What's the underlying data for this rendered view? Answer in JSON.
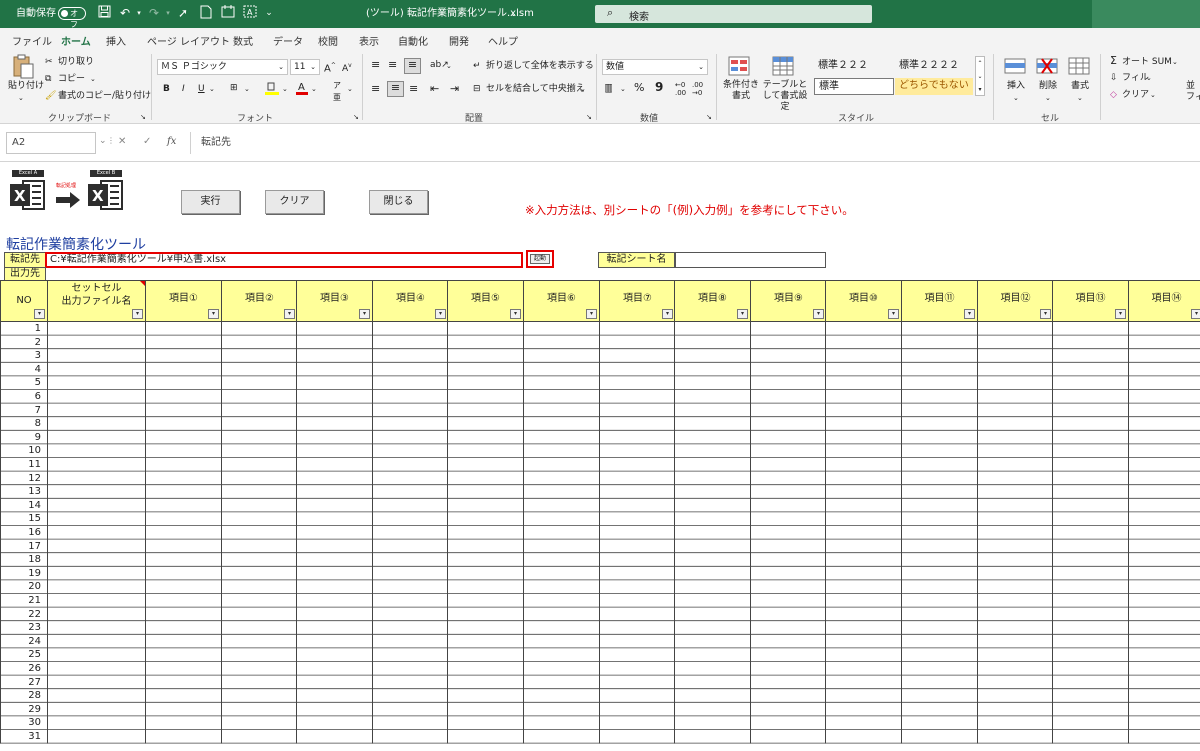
{
  "titlebar": {
    "autosave_label": "自動保存",
    "autosave_state": "オフ",
    "file_title": "(ツール) 転記作業簡素化ツール.xlsm",
    "search_placeholder": "検索"
  },
  "tabs": [
    "ファイル",
    "ホーム",
    "挿入",
    "ページ レイアウト",
    "数式",
    "データ",
    "校閲",
    "表示",
    "自動化",
    "開発",
    "ヘルプ"
  ],
  "active_tab": "ホーム",
  "ribbon": {
    "clipboard": {
      "paste": "貼り付け",
      "cut": "切り取り",
      "copy": "コピー",
      "format_painter": "書式のコピー/貼り付け",
      "label": "クリップボード"
    },
    "font": {
      "font_name": "ＭＳ Ｐゴシック",
      "font_size": "11",
      "bold": "B",
      "italic": "I",
      "underline": "U",
      "label": "フォント"
    },
    "alignment": {
      "wrap_text": "折り返して全体を表示する",
      "merge_center": "セルを結合して中央揃え",
      "label": "配置"
    },
    "number": {
      "format": "数値",
      "percent": "%",
      "comma": "9",
      "label": "数値"
    },
    "styles": {
      "conditional": "条件付き書式",
      "table": "テーブルとして書式設定",
      "style1": "標準２２２",
      "style2": "標準２２２２",
      "style3": "標準",
      "style4": "どちらでもない",
      "label": "スタイル"
    },
    "cells": {
      "insert": "挿入",
      "delete": "削除",
      "format": "書式",
      "label": "セル"
    },
    "editing": {
      "autosum": "オート SUM",
      "fill": "フィル",
      "clear": "クリア",
      "sort_partial": "並",
      "fi_partial": "フィ"
    }
  },
  "formula_bar": {
    "name_box": "A2",
    "fx": "fx",
    "content": "転記先"
  },
  "sheet": {
    "logo_a": "Excel A",
    "logo_b": "Excel B",
    "arrow_caption": "転記処理",
    "buttons": {
      "run": "実行",
      "clear": "クリア",
      "close": "閉じる"
    },
    "note": "※入力方法は、別シートの「(例)入力例」を参考にして下さい。",
    "tool_title": "転記作業簡素化ツール",
    "dest_label": "転記先",
    "dest_path": "C:¥転記作業簡素化ツール¥申込書.xlsx",
    "launch_button": "起動",
    "sheet_name_label": "転記シート名",
    "output_label": "出力先",
    "headers": {
      "no": "NO",
      "set_cell": "セットセル",
      "output_file": "出力ファイル名",
      "items": [
        "項目①",
        "項目②",
        "項目③",
        "項目④",
        "項目⑤",
        "項目⑥",
        "項目⑦",
        "項目⑧",
        "項目⑨",
        "項目⑩",
        "項目⑪",
        "項目⑫",
        "項目⑬",
        "項目⑭"
      ]
    },
    "row_numbers": [
      "1",
      "2",
      "3",
      "4",
      "5",
      "6",
      "7",
      "8",
      "9",
      "10",
      "11",
      "12",
      "13",
      "14",
      "15",
      "16",
      "17",
      "18",
      "19",
      "20",
      "21",
      "22",
      "23",
      "24",
      "25",
      "26",
      "27",
      "28",
      "29",
      "30",
      "31"
    ]
  },
  "colors": {
    "excel_green": "#217346",
    "header_yellow": "#ffff99",
    "note_red": "#e00000",
    "title_blue": "#1f3fa0"
  }
}
